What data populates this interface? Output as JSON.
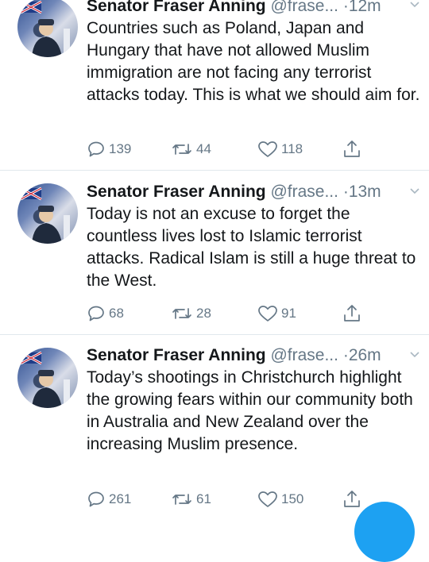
{
  "tweets": [
    {
      "name": "Senator Fraser Anning",
      "handle": "@frase...",
      "dot": "·",
      "time": "12m",
      "text": "Countries such as Poland, Japan and Hungary that have not allowed Muslim immigration are not facing any terrorist attacks today. This is what we should aim for.",
      "replies": "139",
      "retweets": "44",
      "likes": "118"
    },
    {
      "name": "Senator Fraser Anning",
      "handle": "@frase...",
      "dot": "·",
      "time": "13m",
      "text": "Today is not an excuse to forget the countless lives lost to Islamic terrorist attacks. Radical Islam is still a huge threat to the West.",
      "replies": "68",
      "retweets": "28",
      "likes": "91"
    },
    {
      "name": "Senator Fraser Anning",
      "handle": "@frase...",
      "dot": "·",
      "time": "26m",
      "text": "Today’s shootings in Christchurch highlight the growing fears within our community both in Australia and New Zealand over the increasing Muslim presence.",
      "replies": "261",
      "retweets": "61",
      "likes": "150"
    }
  ],
  "icons": {
    "reply": "reply-icon",
    "retweet": "retweet-icon",
    "like": "like-icon",
    "share": "share-icon",
    "more": "chevron-down-icon"
  },
  "colors": {
    "text": "#14171a",
    "secondary": "#657786",
    "divider": "#e1e8ed",
    "accent": "#1da1f2"
  }
}
